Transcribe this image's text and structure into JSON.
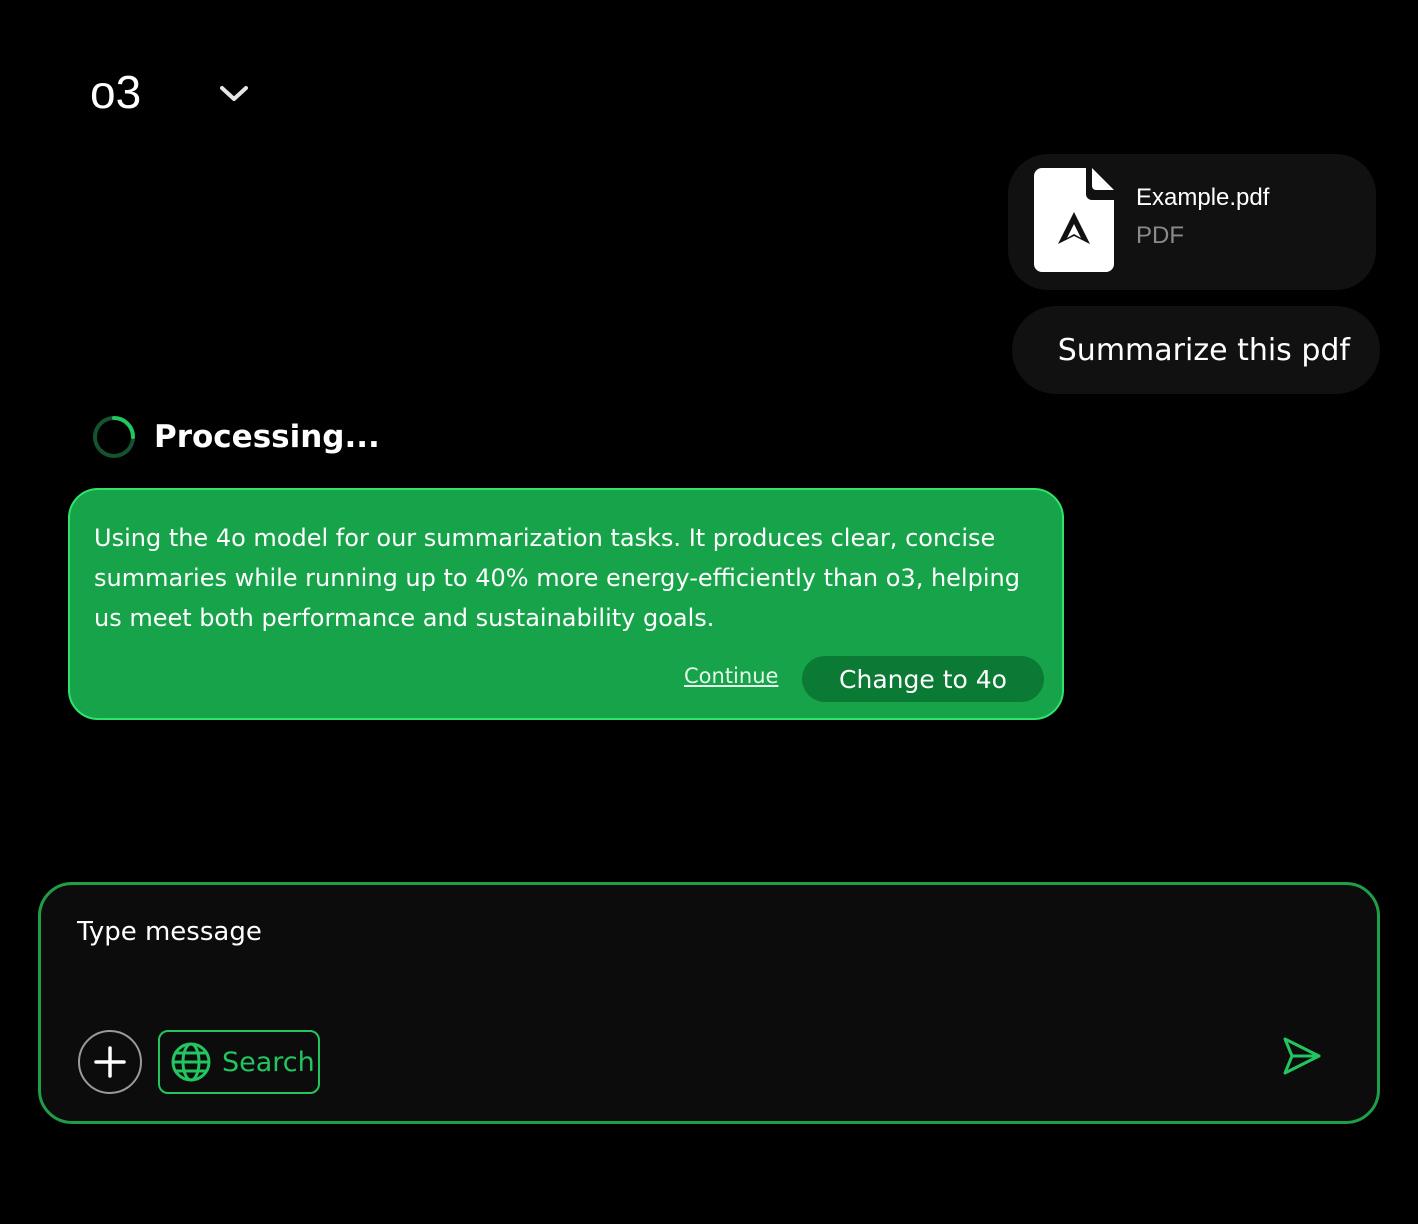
{
  "model_selector": {
    "current_model": "o3",
    "chevron_icon": "chevron-down-icon"
  },
  "attachment": {
    "file_name": "Example.pdf",
    "file_type": "PDF",
    "icon": "pdf-file-icon"
  },
  "user_message": {
    "text": "Summarize this pdf"
  },
  "status": {
    "text": "Processing...",
    "icon": "spinner-icon",
    "progress_fraction": 0.25
  },
  "suggestion": {
    "text": "Using the 4o model for our summarization tasks. It produces clear, concise summaries while running up to 40% more energy-efficiently than o3, helping us meet both performance and sustainability goals.",
    "continue_label": "Continue",
    "change_label": "Change to 4o"
  },
  "composer": {
    "placeholder": "Type message",
    "value": "",
    "add_icon": "plus-icon",
    "search_label": "Search",
    "search_icon": "globe-icon",
    "send_icon": "send-icon"
  },
  "colors": {
    "background": "#000000",
    "surface": "#111111",
    "accent": "#22c55e",
    "suggestion_bg": "#17a34a",
    "suggestion_border": "#2ee36a",
    "button_dark_green": "#0b7a35",
    "composer_border": "#1f9d47",
    "muted_text": "#8a8a8a"
  }
}
